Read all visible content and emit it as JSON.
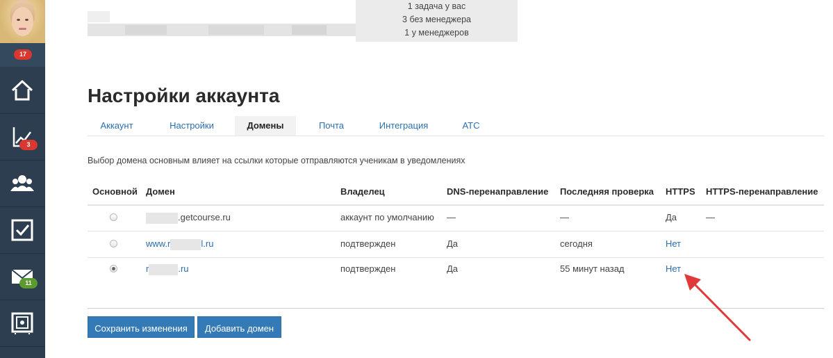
{
  "sidebar": {
    "notification_count": "17",
    "items": [
      {
        "icon": "home-icon"
      },
      {
        "icon": "chart-icon",
        "badge": "3"
      },
      {
        "icon": "users-icon"
      },
      {
        "icon": "checkbox-icon"
      },
      {
        "icon": "mail-icon",
        "badge": "11"
      },
      {
        "icon": "safe-icon"
      }
    ]
  },
  "header": {
    "tasks": [
      "1 задача у вас",
      "3 без менеджера",
      "1 у менеджеров"
    ]
  },
  "page": {
    "title": "Настройки аккаунта",
    "tabs": [
      {
        "label": "Аккаунт"
      },
      {
        "label": "Настройки"
      },
      {
        "label": "Домены",
        "active": true
      },
      {
        "label": "Почта"
      },
      {
        "label": "Интеграция"
      },
      {
        "label": "АТС"
      }
    ],
    "hint": "Выбор домена основным влияет на ссылки которые отправляются ученикам в уведомлениях"
  },
  "table": {
    "headers": [
      "Основной",
      "Домен",
      "Владелец",
      "DNS-перенаправление",
      "Последняя проверка",
      "HTTPS",
      "HTTPS-перенаправление"
    ],
    "rows": [
      {
        "primary": false,
        "domain_prefix": "",
        "domain_suffix": ".getcourse.ru",
        "owner": "аккаунт по умолчанию",
        "dns": "—",
        "last_check": "—",
        "https": "Да",
        "https_redirect": "—"
      },
      {
        "primary": false,
        "domain_prefix": "www.r",
        "domain_suffix": "l.ru",
        "owner": "подтвержден",
        "dns": "Да",
        "last_check": "сегодня",
        "https": "Нет",
        "https_redirect": ""
      },
      {
        "primary": true,
        "domain_prefix": "r",
        "domain_suffix": ".ru",
        "owner": "подтвержден",
        "dns": "Да",
        "last_check": "55 минут назад",
        "https": "Нет",
        "https_redirect": ""
      }
    ]
  },
  "buttons": {
    "save": "Сохранить изменения",
    "add_domain": "Добавить домен"
  },
  "colors": {
    "sidebar": "#2c3e50",
    "link": "#2a6fb0",
    "button": "#337ab7",
    "annotation_arrow": "#e0393a"
  }
}
